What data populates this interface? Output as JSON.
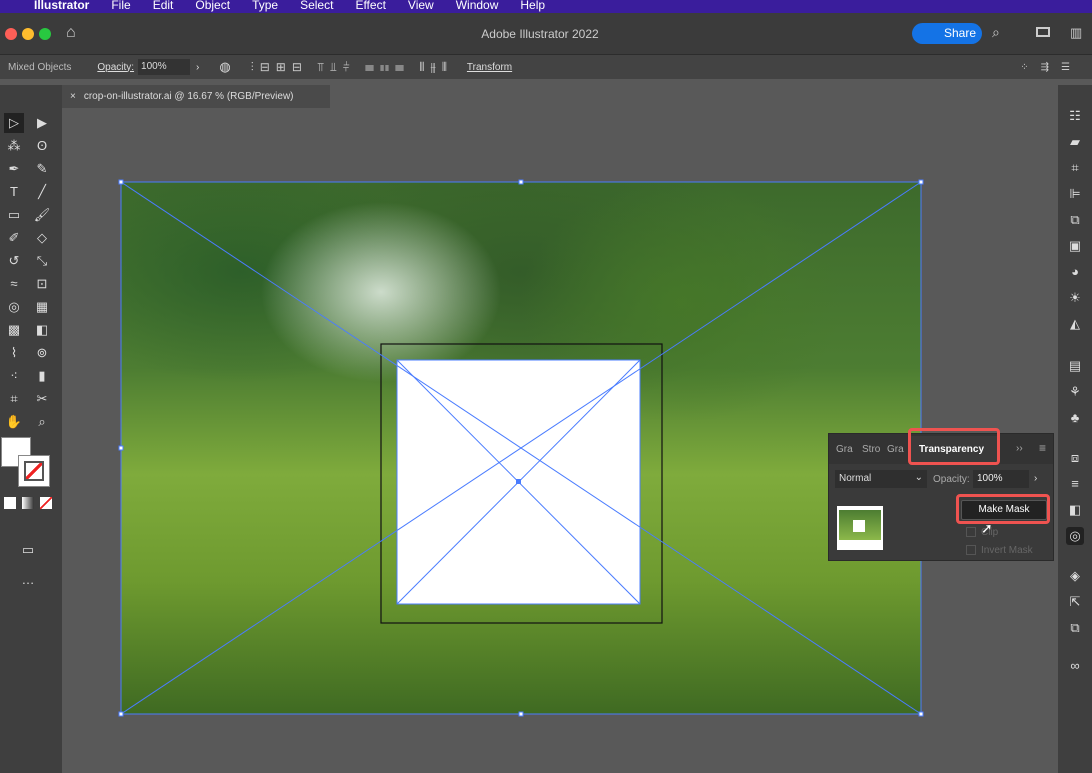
{
  "menubar": {
    "app": "Illustrator",
    "items": [
      "File",
      "Edit",
      "Object",
      "Type",
      "Select",
      "Effect",
      "View",
      "Window",
      "Help"
    ]
  },
  "titlebar": {
    "title": "Adobe Illustrator 2022",
    "share": "Share"
  },
  "control": {
    "selection": "Mixed Objects",
    "opacity_label": "Opacity:",
    "opacity_value": "100%",
    "transform": "Transform"
  },
  "document_tab": {
    "title": "crop-on-illustrator.ai @ 16.67 % (RGB/Preview)"
  },
  "panel": {
    "tabs": [
      "Gra",
      "Stro",
      "Gra",
      "Transparency"
    ],
    "blend_mode": "Normal",
    "opacity_label": "Opacity:",
    "opacity_value": "100%",
    "make_mask": "Make Mask",
    "clip": "Clip",
    "invert_mask": "Invert Mask"
  },
  "colors": {
    "menubar": "#3a1d9c",
    "share": "#1473e6",
    "highlight": "#ef5350",
    "selection": "#4a7cff"
  }
}
